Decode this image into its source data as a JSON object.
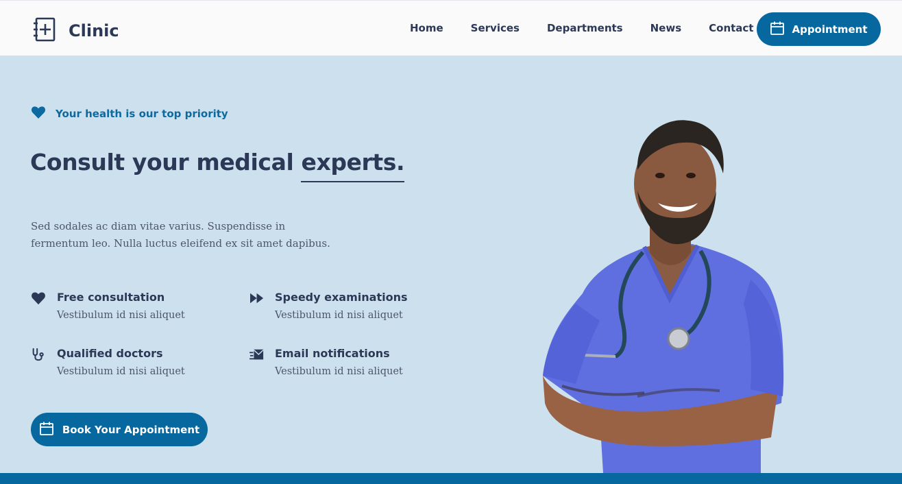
{
  "brand": {
    "name": "Clinic",
    "logo_icon": "medical-book-icon"
  },
  "nav": {
    "items": [
      {
        "label": "Home"
      },
      {
        "label": "Services"
      },
      {
        "label": "Departments"
      },
      {
        "label": "News"
      },
      {
        "label": "Contact"
      }
    ]
  },
  "header": {
    "appointment_label": "Appointment",
    "appointment_icon": "calendar-icon"
  },
  "hero": {
    "eyebrow": "Your health is our top priority",
    "headline_prefix": "Consult your medical ",
    "headline_highlight": "experts.",
    "lede": "Sed sodales ac diam vitae varius. Suspendisse in fermentum leo. Nulla luctus eleifend ex sit amet dapibus.",
    "cta_label": "Book Your Appointment"
  },
  "features": [
    {
      "title": "Free consultation",
      "desc": "Vestibulum id nisi aliquet",
      "icon": "heart-icon"
    },
    {
      "title": "Speedy examinations",
      "desc": "Vestibulum id nisi aliquet",
      "icon": "fast-forward-icon"
    },
    {
      "title": "Qualified doctors",
      "desc": "Vestibulum id nisi aliquet",
      "icon": "stethoscope-icon"
    },
    {
      "title": "Email notifications",
      "desc": "Vestibulum id nisi aliquet",
      "icon": "email-fast-icon"
    }
  ],
  "colors": {
    "brand_blue": "#07679f",
    "navy": "#2b3856",
    "hero_bg": "#cde0ee",
    "header_bg": "#fafafa"
  }
}
